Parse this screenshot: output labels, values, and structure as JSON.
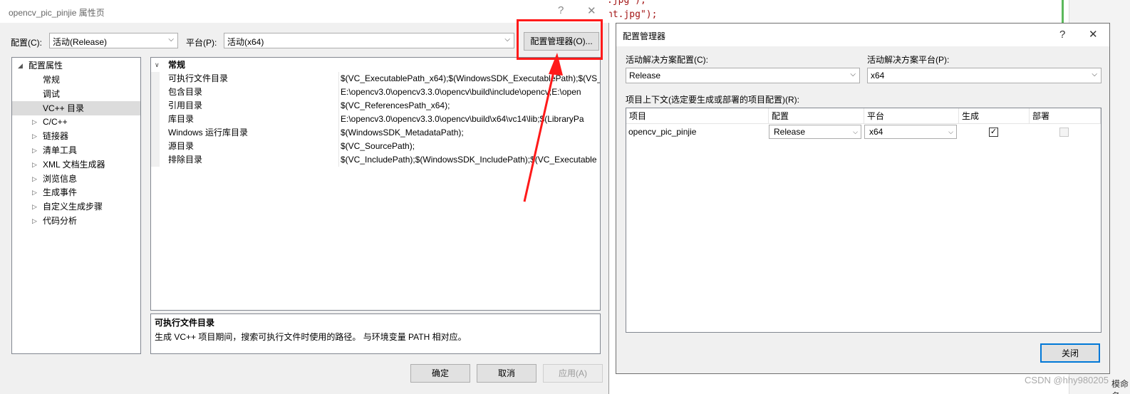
{
  "background": {
    "code_line_1": ".jpg\");",
    "code_line_2": "ht.jpg\");",
    "watermark": "CSDN @hhy980205",
    "side_text": "模命名"
  },
  "props_dialog": {
    "title": "opencv_pic_pinjie 属性页",
    "help": "?",
    "close": "✕",
    "config_label": "配置(C):",
    "config_value": "活动(Release)",
    "platform_label": "平台(P):",
    "platform_value": "活动(x64)",
    "config_manager_button": "配置管理器(O)...",
    "tree": {
      "root": "配置属性",
      "items": [
        {
          "label": "常规",
          "expandable": false,
          "selected": false
        },
        {
          "label": "调试",
          "expandable": false,
          "selected": false
        },
        {
          "label": "VC++ 目录",
          "expandable": false,
          "selected": true
        },
        {
          "label": "C/C++",
          "expandable": true,
          "selected": false
        },
        {
          "label": "链接器",
          "expandable": true,
          "selected": false
        },
        {
          "label": "清单工具",
          "expandable": true,
          "selected": false
        },
        {
          "label": "XML 文档生成器",
          "expandable": true,
          "selected": false
        },
        {
          "label": "浏览信息",
          "expandable": true,
          "selected": false
        },
        {
          "label": "生成事件",
          "expandable": true,
          "selected": false
        },
        {
          "label": "自定义生成步骤",
          "expandable": true,
          "selected": false
        },
        {
          "label": "代码分析",
          "expandable": true,
          "selected": false
        }
      ]
    },
    "grid": {
      "section": "常规",
      "rows": [
        {
          "key": "可执行文件目录",
          "value": "$(VC_ExecutablePath_x64);$(WindowsSDK_ExecutablePath);$(VS_"
        },
        {
          "key": "包含目录",
          "value": "E:\\opencv3.0\\opencv3.3.0\\opencv\\build\\include\\opencv;E:\\open"
        },
        {
          "key": "引用目录",
          "value": "$(VC_ReferencesPath_x64);"
        },
        {
          "key": "库目录",
          "value": "E:\\opencv3.0\\opencv3.3.0\\opencv\\build\\x64\\vc14\\lib;$(LibraryPa"
        },
        {
          "key": "Windows 运行库目录",
          "value": "$(WindowsSDK_MetadataPath);"
        },
        {
          "key": "源目录",
          "value": "$(VC_SourcePath);"
        },
        {
          "key": "排除目录",
          "value": "$(VC_IncludePath);$(WindowsSDK_IncludePath);$(VC_Executable"
        }
      ]
    },
    "description": {
      "title": "可执行文件目录",
      "text": "生成 VC++ 项目期间，搜索可执行文件时使用的路径。 与环境变量 PATH 相对应。"
    },
    "buttons": {
      "ok": "确定",
      "cancel": "取消",
      "apply": "应用(A)"
    }
  },
  "config_manager": {
    "title": "配置管理器",
    "help": "?",
    "close": "✕",
    "active_config_label": "活动解决方案配置(C):",
    "active_config_value": "Release",
    "active_platform_label": "活动解决方案平台(P):",
    "active_platform_value": "x64",
    "context_label": "项目上下文(选定要生成或部署的项目配置)(R):",
    "columns": [
      "项目",
      "配置",
      "平台",
      "生成",
      "部署"
    ],
    "rows": [
      {
        "project": "opencv_pic_pinjie",
        "config": "Release",
        "platform": "x64",
        "build": true,
        "deploy": false
      }
    ],
    "close_button": "关闭"
  },
  "colors": {
    "highlight_box": "#ff1a1a",
    "dialog_bg": "#f0f0f0",
    "selection": "#dcdcdc"
  }
}
